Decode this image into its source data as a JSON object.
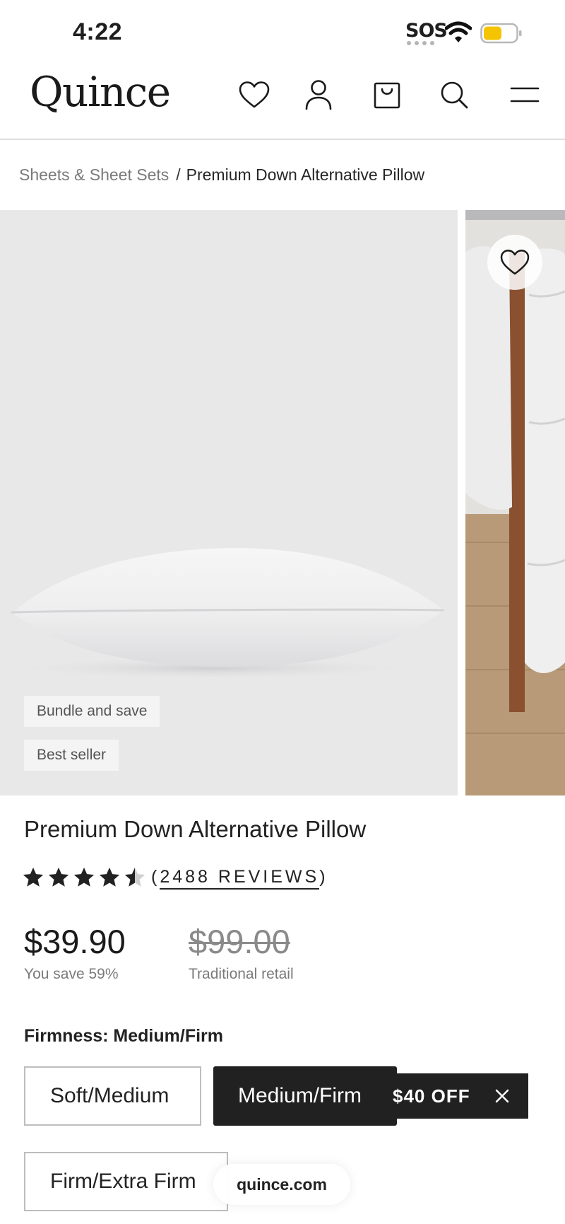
{
  "status_bar": {
    "time": "4:22",
    "sos": "SOS"
  },
  "header": {
    "logo": "Quince",
    "icons": [
      "heart-icon",
      "user-icon",
      "shopping-bag-icon",
      "search-icon",
      "menu-icon"
    ]
  },
  "breadcrumb": {
    "parent": "Sheets & Sheet Sets",
    "separator": "/",
    "current": "Premium Down Alternative Pillow"
  },
  "gallery": {
    "badges": [
      "Bundle and save",
      "Best seller"
    ]
  },
  "product": {
    "title": "Premium Down Alternative Pillow",
    "rating": 4.5,
    "reviews_open": "(",
    "reviews_label": "2488 REVIEWS",
    "reviews_close": ")",
    "price": "$39.90",
    "savings": "You save 59%",
    "retail_price": "$99.00",
    "retail_label": "Traditional retail"
  },
  "firmness": {
    "label": "Firmness: Medium/Firm",
    "options": [
      "Soft/Medium",
      "Medium/Firm",
      "Firm/Extra Firm"
    ],
    "selected": "Medium/Firm"
  },
  "promo": {
    "text": "$40 OFF"
  },
  "browser": {
    "url": "quince.com"
  },
  "colors": {
    "dark": "#212121",
    "battery": "#f5c400",
    "gallery_bg": "#e8e8e9"
  }
}
